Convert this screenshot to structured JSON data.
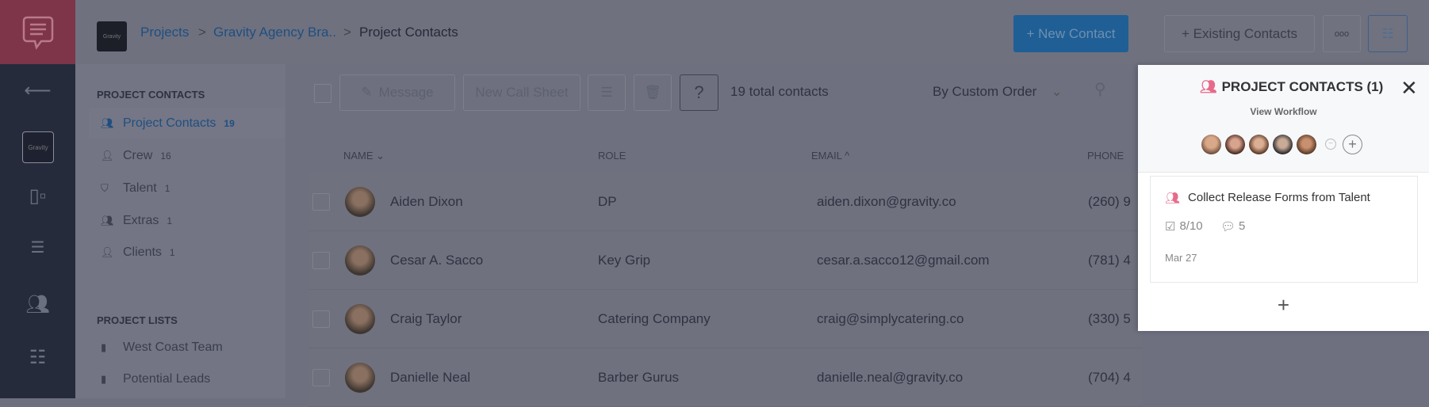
{
  "breadcrumb": {
    "logo": "Gravity",
    "items": [
      "Projects",
      "Gravity Agency Bra..",
      "Project Contacts"
    ],
    "separator": ">"
  },
  "header": {
    "new_contact": "+ New Contact",
    "existing_contacts": "+ Existing Contacts",
    "more": "ooo"
  },
  "rail": {
    "project_logo": "Gravity",
    "icons": [
      "back-arrow-icon",
      "board-icon",
      "gantt-icon",
      "contacts-icon",
      "list-icon"
    ]
  },
  "sidebar": {
    "contacts_heading": "PROJECT CONTACTS",
    "contacts": [
      {
        "label": "Project Contacts",
        "count": "19"
      },
      {
        "label": "Crew",
        "count": "16"
      },
      {
        "label": "Talent",
        "count": "1"
      },
      {
        "label": "Extras",
        "count": "1"
      },
      {
        "label": "Clients",
        "count": "1"
      }
    ],
    "lists_heading": "PROJECT LISTS",
    "lists": [
      {
        "label": "West Coast Team"
      },
      {
        "label": "Potential Leads"
      }
    ]
  },
  "toolbar": {
    "message": "Message",
    "new_call_sheet": "New Call Sheet",
    "help": "?",
    "total": "19 total contacts",
    "sort": "By Custom Order"
  },
  "table": {
    "columns": [
      "NAME ⌄",
      "ROLE",
      "EMAIL ^",
      "PHONE"
    ],
    "rows": [
      {
        "name": "Aiden Dixon",
        "role": "DP",
        "email": "aiden.dixon@gravity.co",
        "phone": "(260) 9"
      },
      {
        "name": "Cesar A. Sacco",
        "role": "Key Grip",
        "email": "cesar.a.sacco12@gmail.com",
        "phone": "(781) 4"
      },
      {
        "name": "Craig Taylor",
        "role": "Catering Company",
        "email": "craig@simplycatering.co",
        "phone": "(330) 5"
      },
      {
        "name": "Danielle Neal",
        "role": "Barber Gurus",
        "email": "danielle.neal@gravity.co",
        "phone": "(704) 4"
      }
    ]
  },
  "panel": {
    "title": "PROJECT CONTACTS (1)",
    "view_workflow": "View Workflow",
    "card": {
      "title": "Collect Release Forms from Talent",
      "checklist": "8/10",
      "comments": "5",
      "date": "Mar 27"
    },
    "add": "+",
    "accent": "#e86a8a"
  },
  "colors": {
    "primary": "#1f5f96",
    "brand": "#7e3549"
  }
}
